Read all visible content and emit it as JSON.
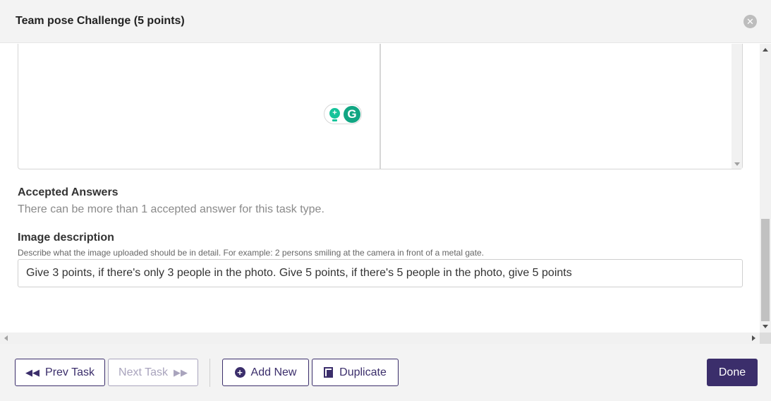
{
  "modal": {
    "title": "Team pose Challenge (5 points)",
    "close_icon": "close-icon"
  },
  "sections": {
    "accepted_answers": {
      "label": "Accepted Answers",
      "help": "There can be more than 1 accepted answer for this task type."
    },
    "image_description": {
      "label": "Image description",
      "help": "Describe what the image uploaded should be in detail. For example: 2 persons smiling at the camera in front of a metal gate.",
      "value": "Give 3 points, if there's only 3 people in the photo. Give 5 points, if there's 5 people in the photo, give 5 points"
    }
  },
  "footer": {
    "prev_label": "Prev Task",
    "next_label": "Next Task",
    "add_label": "Add New",
    "duplicate_label": "Duplicate",
    "done_label": "Done"
  },
  "colors": {
    "accent": "#3b2e6b",
    "disabled": "#a9a4bd",
    "grammarly": "#15c39a"
  }
}
